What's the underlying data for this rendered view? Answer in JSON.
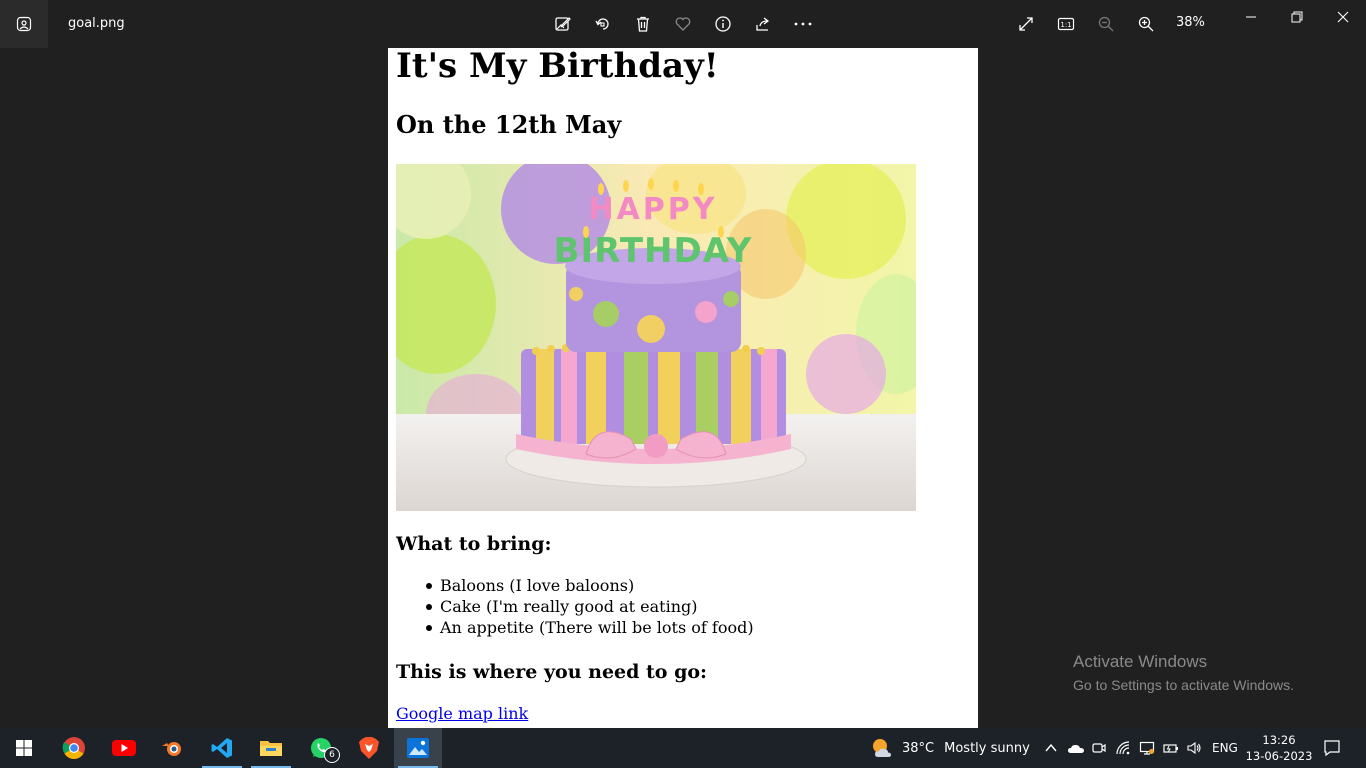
{
  "window": {
    "file_name": "goal.png",
    "zoom_level": "38%"
  },
  "document": {
    "heading": "It's My Birthday!",
    "date_heading": "On the 12th May",
    "bring_heading": "What to bring:",
    "bring_items": [
      "Baloons (I love baloons)",
      "Cake (I'm really good at eating)",
      "An appetite (There will be lots of food)"
    ],
    "go_heading": "This is where you need to go:",
    "map_link": "Google map link",
    "cake_candle_text": "HAPPY BIRTHDAY"
  },
  "watermark": {
    "title": "Activate Windows",
    "subtitle": "Go to Settings to activate Windows."
  },
  "taskbar": {
    "whatsapp_badge": "6",
    "temperature": "38°C",
    "weather_text": "Mostly sunny",
    "language": "ENG",
    "time": "13:26",
    "date": "13-06-2023"
  }
}
